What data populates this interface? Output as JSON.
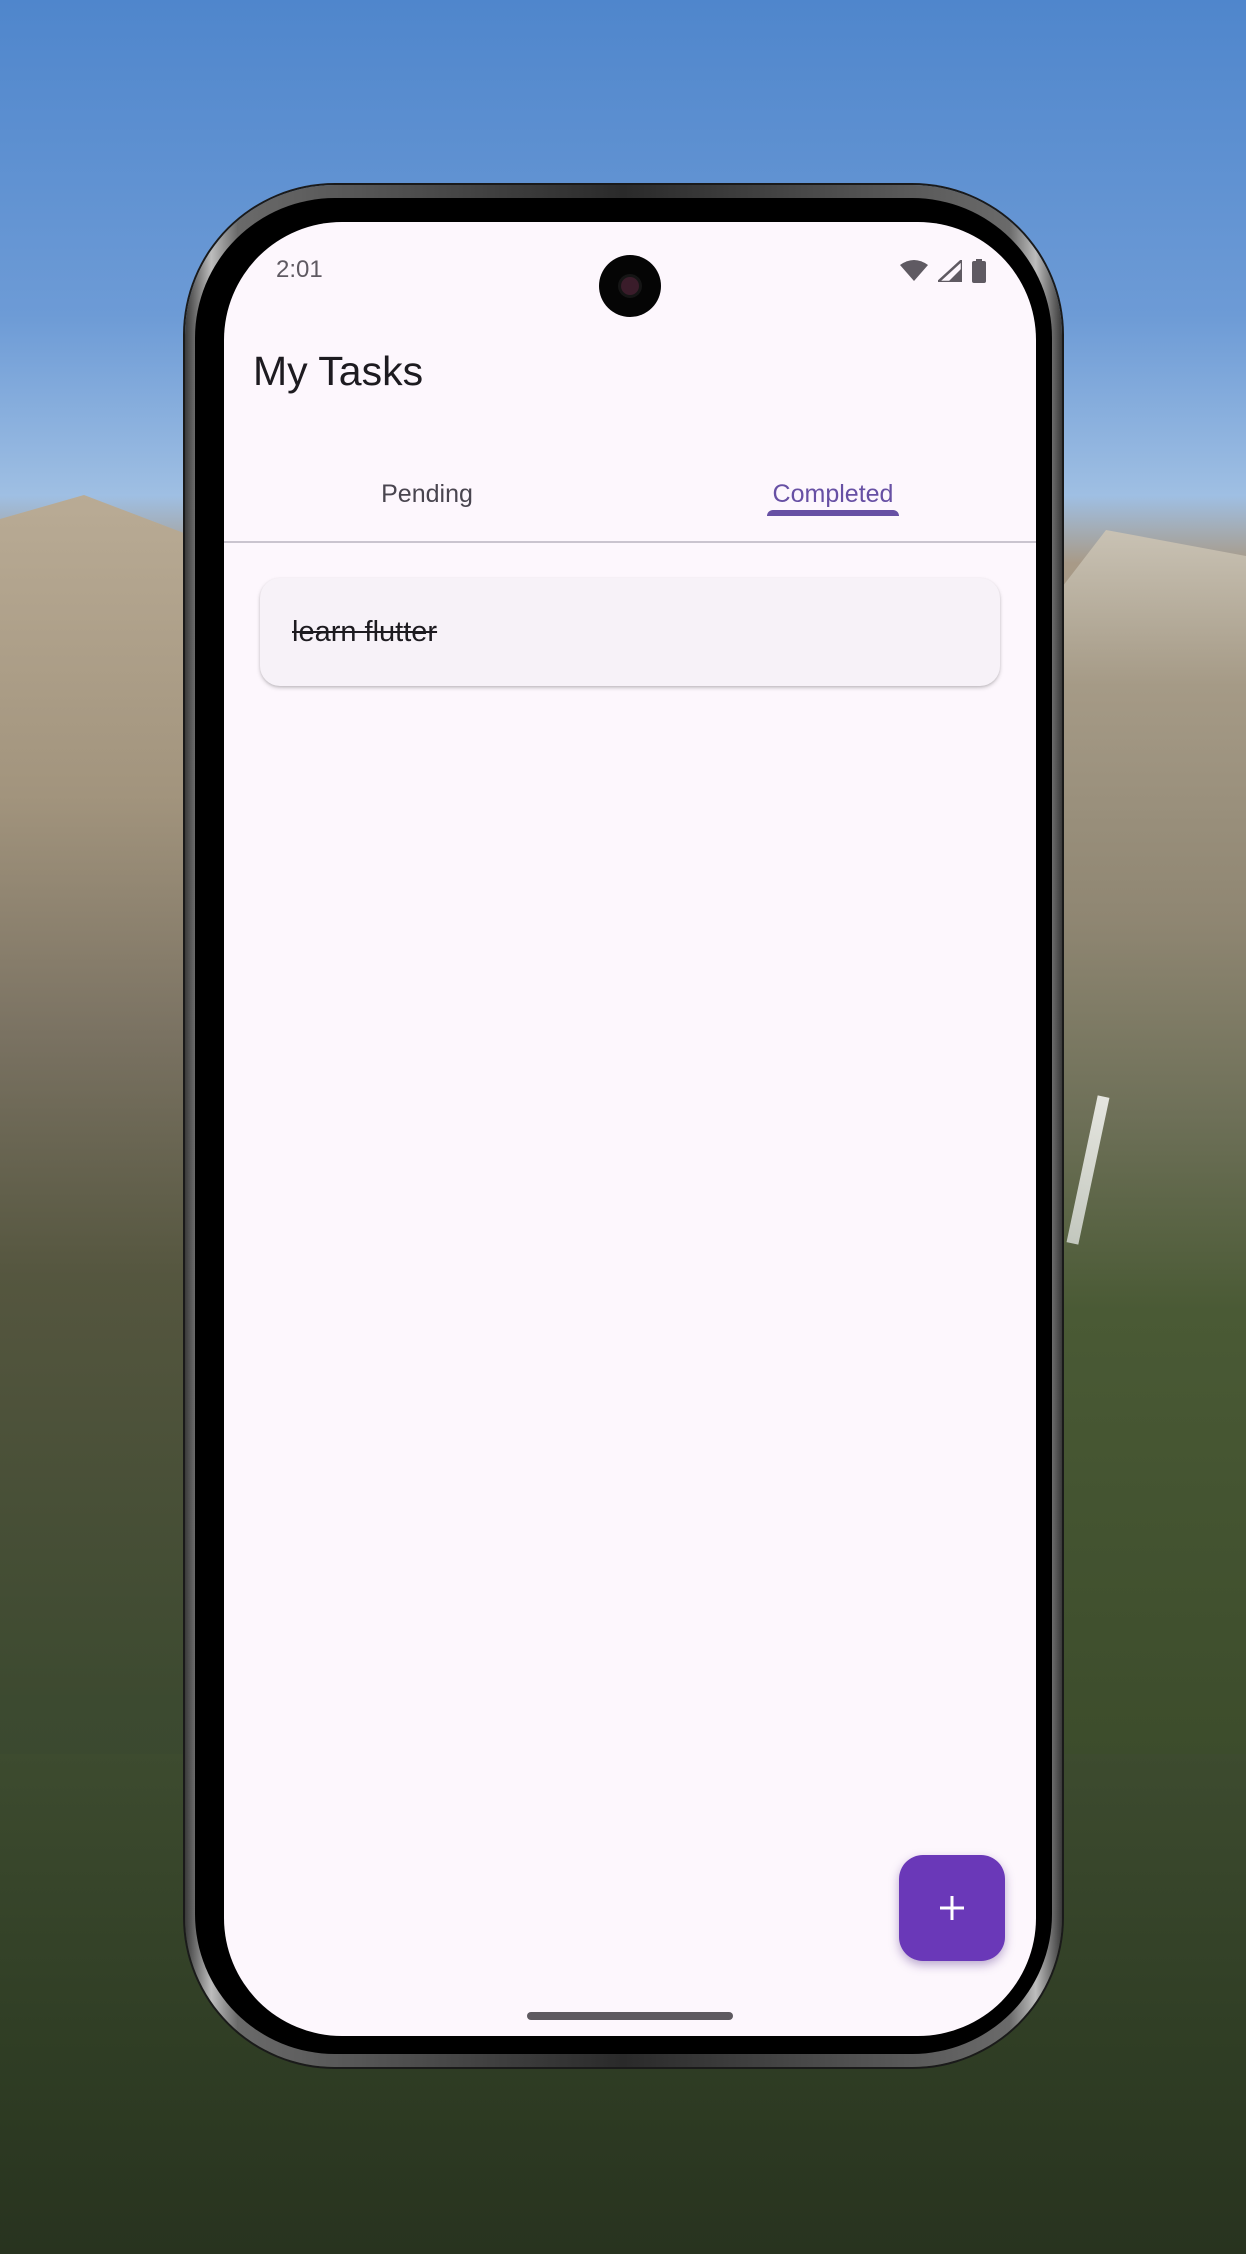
{
  "status_bar": {
    "time": "2:01",
    "icons": [
      "wifi-icon",
      "signal-icon",
      "battery-icon"
    ]
  },
  "app": {
    "title": "My Tasks"
  },
  "tabs": [
    {
      "label": "Pending",
      "selected": false
    },
    {
      "label": "Completed",
      "selected": true
    }
  ],
  "tasks": [
    {
      "text": "learn flutter",
      "completed": true
    }
  ],
  "fab": {
    "icon": "plus-icon"
  },
  "colors": {
    "accent": "#6750a4",
    "fab": "#6a38b8",
    "background": "#fdf7fd",
    "card": "#f7f2f8"
  }
}
